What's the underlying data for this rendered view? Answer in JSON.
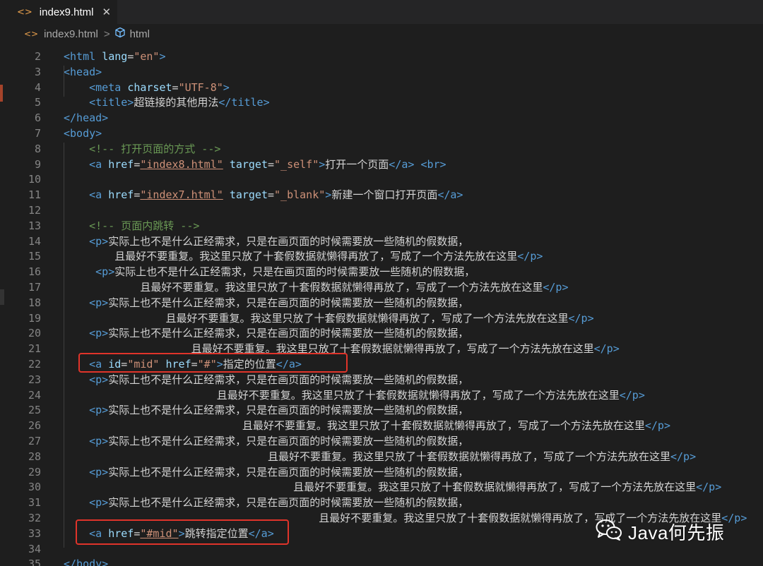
{
  "tab": {
    "file_icon": "<>",
    "label": "index9.html",
    "close": "✕"
  },
  "breadcrumb": {
    "file_icon": "<>",
    "file": "index9.html",
    "separator": ">",
    "element": "html"
  },
  "lines": [
    {
      "n": "2",
      "tokens": [
        {
          "c": "tg",
          "t": "<html "
        },
        {
          "c": "at",
          "t": "lang"
        },
        {
          "c": "cn",
          "t": "="
        },
        {
          "c": "st",
          "t": "\"en\""
        },
        {
          "c": "tg",
          "t": ">"
        }
      ]
    },
    {
      "n": "3",
      "tokens": [
        {
          "c": "tg",
          "t": "<head>"
        }
      ]
    },
    {
      "n": "4",
      "tokens": [
        {
          "c": "tg",
          "t": "    <meta "
        },
        {
          "c": "at",
          "t": "charset"
        },
        {
          "c": "cn",
          "t": "="
        },
        {
          "c": "st",
          "t": "\"UTF-8\""
        },
        {
          "c": "tg",
          "t": ">"
        }
      ]
    },
    {
      "n": "5",
      "tokens": [
        {
          "c": "tg",
          "t": "    <title>"
        },
        {
          "c": "cn",
          "t": "超链接的其他用法"
        },
        {
          "c": "tg",
          "t": "</title>"
        }
      ]
    },
    {
      "n": "6",
      "tokens": [
        {
          "c": "tg",
          "t": "</head>"
        }
      ]
    },
    {
      "n": "7",
      "tokens": [
        {
          "c": "tg",
          "t": "<body>"
        }
      ]
    },
    {
      "n": "8",
      "tokens": [
        {
          "c": "cm",
          "t": "    <!-- 打开页面的方式 -->"
        }
      ]
    },
    {
      "n": "9",
      "tokens": [
        {
          "c": "tg",
          "t": "    <a "
        },
        {
          "c": "at",
          "t": "href"
        },
        {
          "c": "cn",
          "t": "="
        },
        {
          "c": "st ul",
          "t": "\"index8.html\""
        },
        {
          "c": "cn",
          "t": " "
        },
        {
          "c": "at",
          "t": "target"
        },
        {
          "c": "cn",
          "t": "="
        },
        {
          "c": "st",
          "t": "\"_self\""
        },
        {
          "c": "tg",
          "t": ">"
        },
        {
          "c": "cn",
          "t": "打开一个页面"
        },
        {
          "c": "tg",
          "t": "</a>"
        },
        {
          "c": "cn",
          "t": " "
        },
        {
          "c": "tg",
          "t": "<br>"
        }
      ]
    },
    {
      "n": "10",
      "tokens": []
    },
    {
      "n": "11",
      "tokens": [
        {
          "c": "tg",
          "t": "    <a "
        },
        {
          "c": "at",
          "t": "href"
        },
        {
          "c": "cn",
          "t": "="
        },
        {
          "c": "st ul",
          "t": "\"index7.html\""
        },
        {
          "c": "cn",
          "t": " "
        },
        {
          "c": "at",
          "t": "target"
        },
        {
          "c": "cn",
          "t": "="
        },
        {
          "c": "st",
          "t": "\"_blank\""
        },
        {
          "c": "tg",
          "t": ">"
        },
        {
          "c": "cn",
          "t": "新建一个窗口打开页面"
        },
        {
          "c": "tg",
          "t": "</a>"
        }
      ]
    },
    {
      "n": "12",
      "tokens": []
    },
    {
      "n": "13",
      "tokens": [
        {
          "c": "cm",
          "t": "    <!-- 页面内跳转 -->"
        }
      ]
    },
    {
      "n": "14",
      "tokens": [
        {
          "c": "tg",
          "t": "    <p>"
        },
        {
          "c": "cn",
          "t": "实际上也不是什么正经需求，只是在画页面的时候需要放一些随机的假数据，"
        }
      ]
    },
    {
      "n": "15",
      "tokens": [
        {
          "c": "cn",
          "t": "        且最好不要重复。我这里只放了十套假数据就懒得再放了，写成了一个方法先放在这里"
        },
        {
          "c": "tg",
          "t": "</p>"
        }
      ]
    },
    {
      "n": "16",
      "tokens": [
        {
          "c": "tg",
          "t": "     <p>"
        },
        {
          "c": "cn",
          "t": "实际上也不是什么正经需求，只是在画页面的时候需要放一些随机的假数据，"
        }
      ]
    },
    {
      "n": "17",
      "tokens": [
        {
          "c": "cn",
          "t": "            且最好不要重复。我这里只放了十套假数据就懒得再放了，写成了一个方法先放在这里"
        },
        {
          "c": "tg",
          "t": "</p>"
        }
      ]
    },
    {
      "n": "18",
      "tokens": [
        {
          "c": "tg",
          "t": "    <p>"
        },
        {
          "c": "cn",
          "t": "实际上也不是什么正经需求，只是在画页面的时候需要放一些随机的假数据，"
        }
      ]
    },
    {
      "n": "19",
      "tokens": [
        {
          "c": "cn",
          "t": "                且最好不要重复。我这里只放了十套假数据就懒得再放了，写成了一个方法先放在这里"
        },
        {
          "c": "tg",
          "t": "</p>"
        }
      ]
    },
    {
      "n": "20",
      "tokens": [
        {
          "c": "tg",
          "t": "    <p>"
        },
        {
          "c": "cn",
          "t": "实际上也不是什么正经需求，只是在画页面的时候需要放一些随机的假数据，"
        }
      ]
    },
    {
      "n": "21",
      "tokens": [
        {
          "c": "cn",
          "t": "                    且最好不要重复。我这里只放了十套假数据就懒得再放了，写成了一个方法先放在这里"
        },
        {
          "c": "tg",
          "t": "</p>"
        }
      ]
    },
    {
      "n": "22",
      "tokens": [
        {
          "c": "tg",
          "t": "    <a "
        },
        {
          "c": "at",
          "t": "id"
        },
        {
          "c": "cn",
          "t": "="
        },
        {
          "c": "st",
          "t": "\"mid\""
        },
        {
          "c": "cn",
          "t": " "
        },
        {
          "c": "at",
          "t": "href"
        },
        {
          "c": "cn",
          "t": "="
        },
        {
          "c": "st",
          "t": "\"#\""
        },
        {
          "c": "tg",
          "t": ">"
        },
        {
          "c": "cn",
          "t": "指定的位置"
        },
        {
          "c": "tg",
          "t": "</a>"
        }
      ]
    },
    {
      "n": "23",
      "tokens": [
        {
          "c": "tg",
          "t": "    <p>"
        },
        {
          "c": "cn",
          "t": "实际上也不是什么正经需求，只是在画页面的时候需要放一些随机的假数据，"
        }
      ]
    },
    {
      "n": "24",
      "tokens": [
        {
          "c": "cn",
          "t": "                        且最好不要重复。我这里只放了十套假数据就懒得再放了，写成了一个方法先放在这里"
        },
        {
          "c": "tg",
          "t": "</p>"
        }
      ]
    },
    {
      "n": "25",
      "tokens": [
        {
          "c": "tg",
          "t": "    <p>"
        },
        {
          "c": "cn",
          "t": "实际上也不是什么正经需求，只是在画页面的时候需要放一些随机的假数据，"
        }
      ]
    },
    {
      "n": "26",
      "tokens": [
        {
          "c": "cn",
          "t": "                            且最好不要重复。我这里只放了十套假数据就懒得再放了，写成了一个方法先放在这里"
        },
        {
          "c": "tg",
          "t": "</p>"
        }
      ]
    },
    {
      "n": "27",
      "tokens": [
        {
          "c": "tg",
          "t": "    <p>"
        },
        {
          "c": "cn",
          "t": "实际上也不是什么正经需求，只是在画页面的时候需要放一些随机的假数据，"
        }
      ]
    },
    {
      "n": "28",
      "tokens": [
        {
          "c": "cn",
          "t": "                                且最好不要重复。我这里只放了十套假数据就懒得再放了，写成了一个方法先放在这里"
        },
        {
          "c": "tg",
          "t": "</p>"
        }
      ]
    },
    {
      "n": "29",
      "tokens": [
        {
          "c": "tg",
          "t": "    <p>"
        },
        {
          "c": "cn",
          "t": "实际上也不是什么正经需求，只是在画页面的时候需要放一些随机的假数据，"
        }
      ]
    },
    {
      "n": "30",
      "tokens": [
        {
          "c": "cn",
          "t": "                                    且最好不要重复。我这里只放了十套假数据就懒得再放了，写成了一个方法先放在这里"
        },
        {
          "c": "tg",
          "t": "</p>"
        }
      ]
    },
    {
      "n": "31",
      "tokens": [
        {
          "c": "tg",
          "t": "    <p>"
        },
        {
          "c": "cn",
          "t": "实际上也不是什么正经需求，只是在画页面的时候需要放一些随机的假数据，"
        }
      ]
    },
    {
      "n": "32",
      "tokens": [
        {
          "c": "cn",
          "t": "                                        且最好不要重复。我这里只放了十套假数据就懒得再放了，写成了一个方法先放在这里"
        },
        {
          "c": "tg",
          "t": "</p>"
        }
      ]
    },
    {
      "n": "33",
      "tokens": [
        {
          "c": "tg",
          "t": "    <a "
        },
        {
          "c": "at",
          "t": "href"
        },
        {
          "c": "cn",
          "t": "="
        },
        {
          "c": "st ul",
          "t": "\"#mid\""
        },
        {
          "c": "tg",
          "t": ">"
        },
        {
          "c": "cn",
          "t": "跳转指定位置"
        },
        {
          "c": "tg",
          "t": "</a>"
        }
      ]
    },
    {
      "n": "34",
      "tokens": []
    },
    {
      "n": "35",
      "tokens": [
        {
          "c": "tg",
          "t": "</body>"
        }
      ]
    }
  ],
  "watermark": {
    "icon": "wechat-icon",
    "text": "Java何先振"
  },
  "colors": {
    "tag": "#569cd6",
    "attribute": "#9cdcfe",
    "string": "#ce9178",
    "comment": "#6a9955",
    "text": "#d4d4d4",
    "highlight_box": "#e0342a"
  }
}
